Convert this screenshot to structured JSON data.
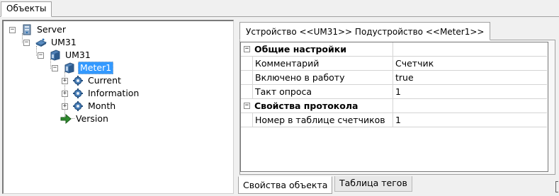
{
  "top_tab": {
    "label": "Объекты"
  },
  "tree": {
    "nodes": [
      {
        "label": "Server",
        "icon": "server-icon",
        "expander": "−"
      },
      {
        "label": "UM31",
        "icon": "router-icon",
        "expander": "−"
      },
      {
        "label": "UM31",
        "icon": "device-icon",
        "expander": "−"
      },
      {
        "label": "Meter1",
        "icon": "meter-icon",
        "expander": "−",
        "selected": true
      },
      {
        "label": "Current",
        "icon": "gear-icon",
        "expander": "+"
      },
      {
        "label": "Information",
        "icon": "gear-icon",
        "expander": "+"
      },
      {
        "label": "Month",
        "icon": "gear-icon",
        "expander": "+"
      },
      {
        "label": "Version",
        "icon": "arrow-icon",
        "expander": ""
      }
    ]
  },
  "device_tab": {
    "label": "Устройство <<UM31>> Подустройство <<Meter1>>"
  },
  "properties": {
    "categories": [
      {
        "name": "Общие настройки",
        "toggle": "−",
        "rows": [
          {
            "name": "Комментарий",
            "value": "Счетчик"
          },
          {
            "name": "Включено в работу",
            "value": "true"
          },
          {
            "name": "Такт опроса",
            "value": "1"
          }
        ]
      },
      {
        "name": "Свойства протокола",
        "toggle": "−",
        "rows": [
          {
            "name": "Номер в таблице счетчиков",
            "value": "1"
          }
        ]
      }
    ]
  },
  "bottom_tabs": [
    {
      "label": "Свойства объекта",
      "active": true
    },
    {
      "label": "Таблица тегов",
      "active": false
    }
  ],
  "colors": {
    "selection": "#3399ff",
    "icon_blue": "#2a6fb0"
  }
}
